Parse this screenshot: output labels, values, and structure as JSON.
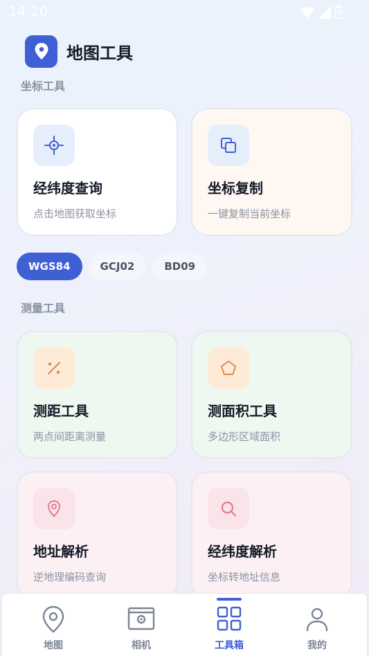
{
  "status_bar": {
    "time": "14:20"
  },
  "header": {
    "title": "地图工具",
    "icon": "map-pin-icon"
  },
  "sections": {
    "coordinate": {
      "title": "坐标工具",
      "cards": [
        {
          "title": "经纬度查询",
          "subtitle": "点击地图获取坐标",
          "icon": "crosshair-icon"
        },
        {
          "title": "坐标复制",
          "subtitle": "一键复制当前坐标",
          "icon": "copy-icon"
        }
      ],
      "chips": [
        {
          "label": "WGS84",
          "selected": true
        },
        {
          "label": "GCJ02",
          "selected": false
        },
        {
          "label": "BD09",
          "selected": false
        }
      ]
    },
    "measure": {
      "title": "测量工具",
      "cards": [
        {
          "title": "测距工具",
          "subtitle": "两点间距离测量",
          "icon": "percent-icon"
        },
        {
          "title": "测面积工具",
          "subtitle": "多边形区域面积",
          "icon": "pentagon-icon"
        },
        {
          "title": "地址解析",
          "subtitle": "逆地理编码查询",
          "icon": "location-pin-icon"
        },
        {
          "title": "经纬度解析",
          "subtitle": "坐标转地址信息",
          "icon": "search-icon"
        }
      ]
    }
  },
  "bottom_nav": [
    {
      "label": "地图",
      "icon": "map-pin-icon",
      "active": false
    },
    {
      "label": "相机",
      "icon": "camera-icon",
      "active": false
    },
    {
      "label": "工具箱",
      "icon": "grid-icon",
      "active": true
    },
    {
      "label": "我的",
      "icon": "user-icon",
      "active": false
    }
  ],
  "colors": {
    "accent": "#3f5fd4",
    "card_white": "#ffffff",
    "card_cream": "#fff8f2",
    "card_mint": "#eff7f1",
    "card_pink": "#fcf0f4",
    "icon_blue_bg": "#e6eefc",
    "icon_orange_bg": "#fdebd8",
    "icon_pink_bg": "#fbe3ea"
  }
}
